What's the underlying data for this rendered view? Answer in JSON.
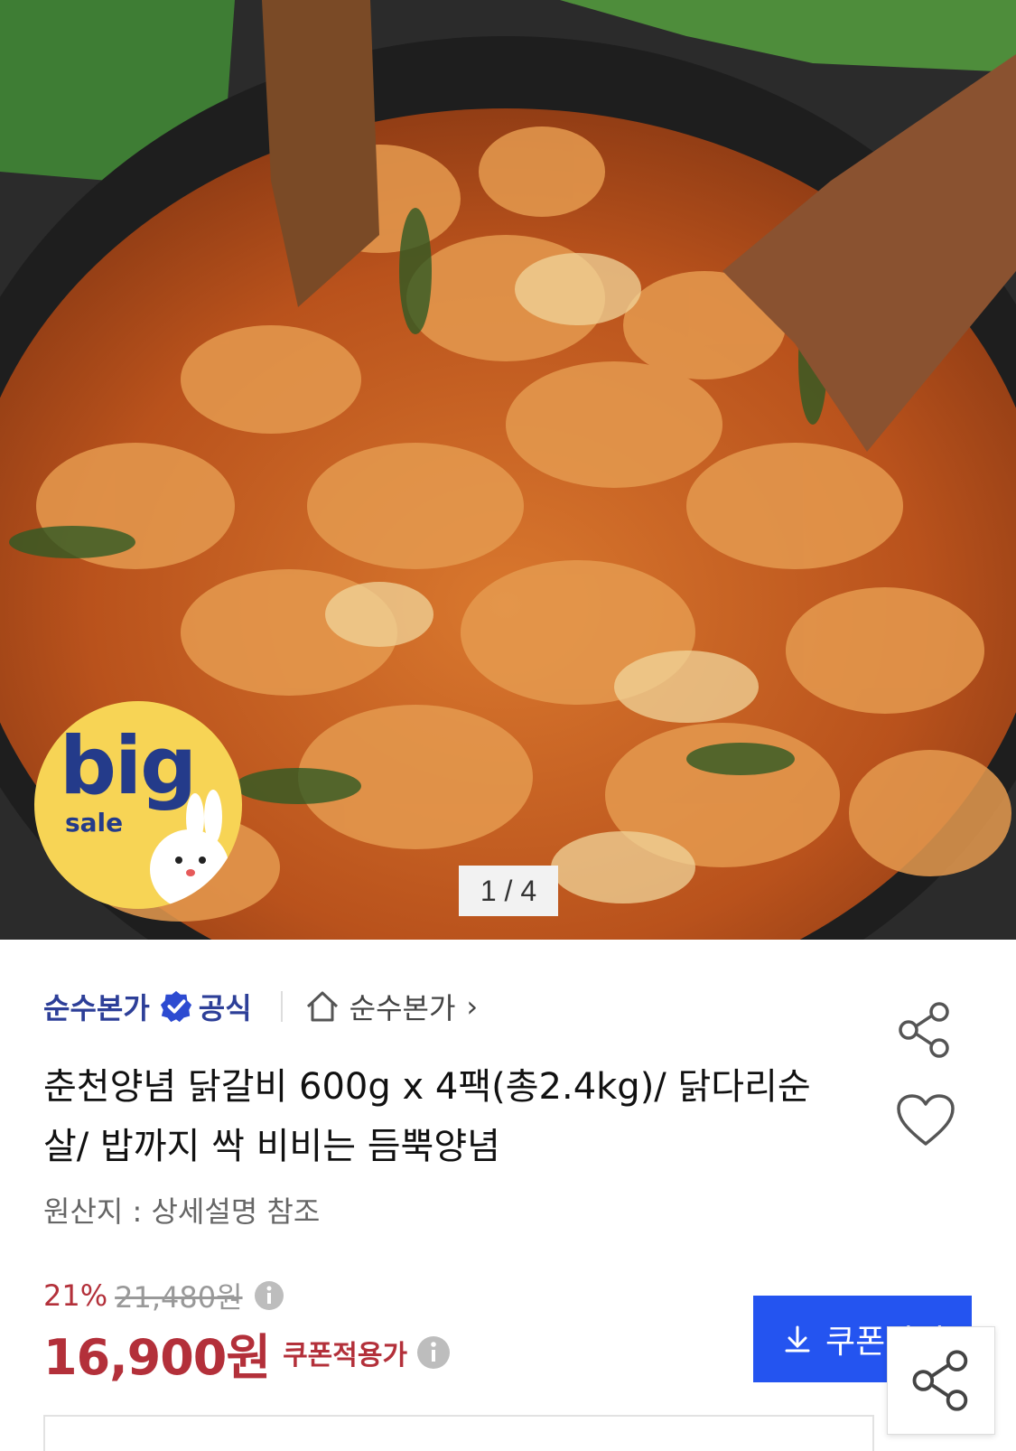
{
  "gallery": {
    "counter": "1 / 4",
    "badge_big": "big",
    "badge_sale": "sale"
  },
  "seller": {
    "name": "순수본가",
    "official_label": "공식",
    "store_link": "순수본가",
    "chevron": "›"
  },
  "product": {
    "title": "춘천양념 닭갈비 600g x 4팩(총2.4kg)/ 닭다리순살/ 밥까지 싹 비비는 듬뿍양념",
    "origin": "원산지 : 상세설명 참조"
  },
  "price": {
    "discount": "21%",
    "original": "21,480원",
    "final": "16,900원",
    "coupon_price_label": "쿠폰적용가"
  },
  "coupon_button": {
    "label": "쿠폰받기"
  },
  "icons": {
    "verified": "verified-check-icon",
    "home": "home-icon",
    "share": "share-icon",
    "heart": "heart-icon",
    "info": "info-icon",
    "download": "download-icon"
  },
  "colors": {
    "brand_blue": "#2d3f98",
    "sale_red": "#b3303a",
    "button_blue": "#2454f0"
  }
}
